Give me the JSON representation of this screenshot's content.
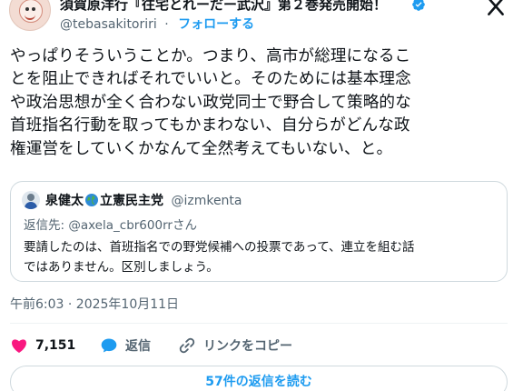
{
  "author": {
    "display_name": "須賀原洋行『往宅とれーだー武沢』第２巻発売開始！",
    "handle": "@tebasakitoriri",
    "separator": "·",
    "follow_label": "フォローする"
  },
  "tweet": {
    "lines": [
      "やっぱりそういうことか。つまり、高市が総理になるこ",
      "とを阻止できればそれでいいと。そのためには基本理念",
      "や政治思想が全く合わない政党同士で野合して策略的な",
      "首班指名行動を取ってもかまわない、自分らがどんな政",
      "権運営をしていくかなんて全然考えてもいない、と。"
    ],
    "timestamp": "午前6:03 · 2025年10月11日"
  },
  "quote": {
    "name": "泉健太",
    "party": "立憲民主党",
    "handle": "@izmkenta",
    "reply_to": "返信先: @axela_cbr600rrさん",
    "lines": [
      "要請したのは、首班指名での野党候補への投票であって、連立を組む話",
      "ではありません。区別しましょう。"
    ]
  },
  "actions": {
    "like_count": "7,151",
    "reply_label": "返信",
    "copy_link_label": "リンクをコピー"
  },
  "read_replies_label": "57件の返信を読む",
  "colors": {
    "accent": "#1d9bf0",
    "like": "#f91880",
    "verified": "#1d9bf0",
    "text": "#0f1419",
    "secondary": "#536471"
  },
  "icons": [
    "verified-badge-icon",
    "close-icon",
    "globe-icon",
    "heart-icon",
    "reply-bubble-icon",
    "link-icon"
  ]
}
